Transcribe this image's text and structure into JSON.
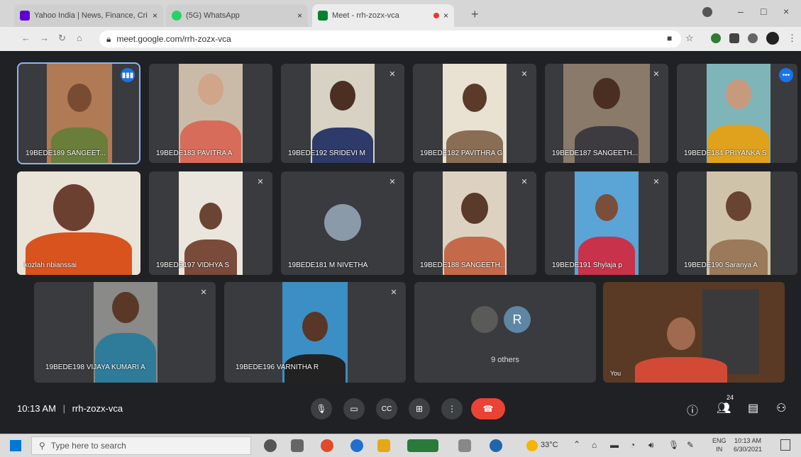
{
  "browser": {
    "tabs": [
      {
        "label": "Yahoo India | News, Finance, Cri",
        "close": "×"
      },
      {
        "label": "(5G) WhatsApp",
        "close": "×"
      },
      {
        "label": "Meet - rrh-zozx-vca",
        "close": "×"
      }
    ],
    "new_tab": "+",
    "url": "meet.google.com/rrh-zozx-vca",
    "window_controls": [
      "–",
      "□",
      "×"
    ]
  },
  "participants": [
    {
      "name": "19BEDE189 SANGEET...",
      "state": "speaking"
    },
    {
      "name": "19BEDE183 PAVITRA A",
      "state": "normal"
    },
    {
      "name": "19BEDE192 SRIDEVI M",
      "state": "muted"
    },
    {
      "name": "19BEDE182 PAVITHRA G",
      "state": "muted"
    },
    {
      "name": "19BEDE187 SANGEETH...",
      "state": "muted"
    },
    {
      "name": "19BEDE184 PRIYANKA S",
      "state": "speaking"
    },
    {
      "name": "kozlah nbianssai",
      "state": "normal"
    },
    {
      "name": "19BEDE197 VIDHYA S",
      "state": "muted"
    },
    {
      "name": "19BEDE181 M NIVETHA",
      "state": "muted"
    },
    {
      "name": "19BEDE188 SANGEETH...",
      "state": "muted"
    },
    {
      "name": "19BEDE191 Shylaja p",
      "state": "muted"
    },
    {
      "name": "19BEDE190 Saranya A",
      "state": "normal"
    },
    {
      "name": "19BEDE198 VIJAYA KUMARI A",
      "state": "muted"
    },
    {
      "name": "19BEDE196 VARNITHA R",
      "state": "muted"
    }
  ],
  "others": {
    "avatar_letter": "R",
    "label": "9 others"
  },
  "self_tile": {
    "label": "You"
  },
  "meeting": {
    "time": "10:13 AM",
    "separator": "|",
    "code": "rrh-zozx-vca"
  },
  "controls": {
    "mic": "mic-icon",
    "camera": "camera-icon",
    "captions": "CC",
    "present": "present-icon",
    "more": "⋮",
    "end_call": "end-call-icon"
  },
  "right_controls": {
    "people_count": "24"
  },
  "taskbar": {
    "search_placeholder": "Type here to search",
    "weather": "33°C",
    "lang": "ENG",
    "region": "IN",
    "time": "10:13 AM",
    "date": "6/30/2021"
  },
  "colors": {
    "meet_bg": "#202124",
    "accent": "#1a73e8",
    "end_call": "#ea4335"
  }
}
